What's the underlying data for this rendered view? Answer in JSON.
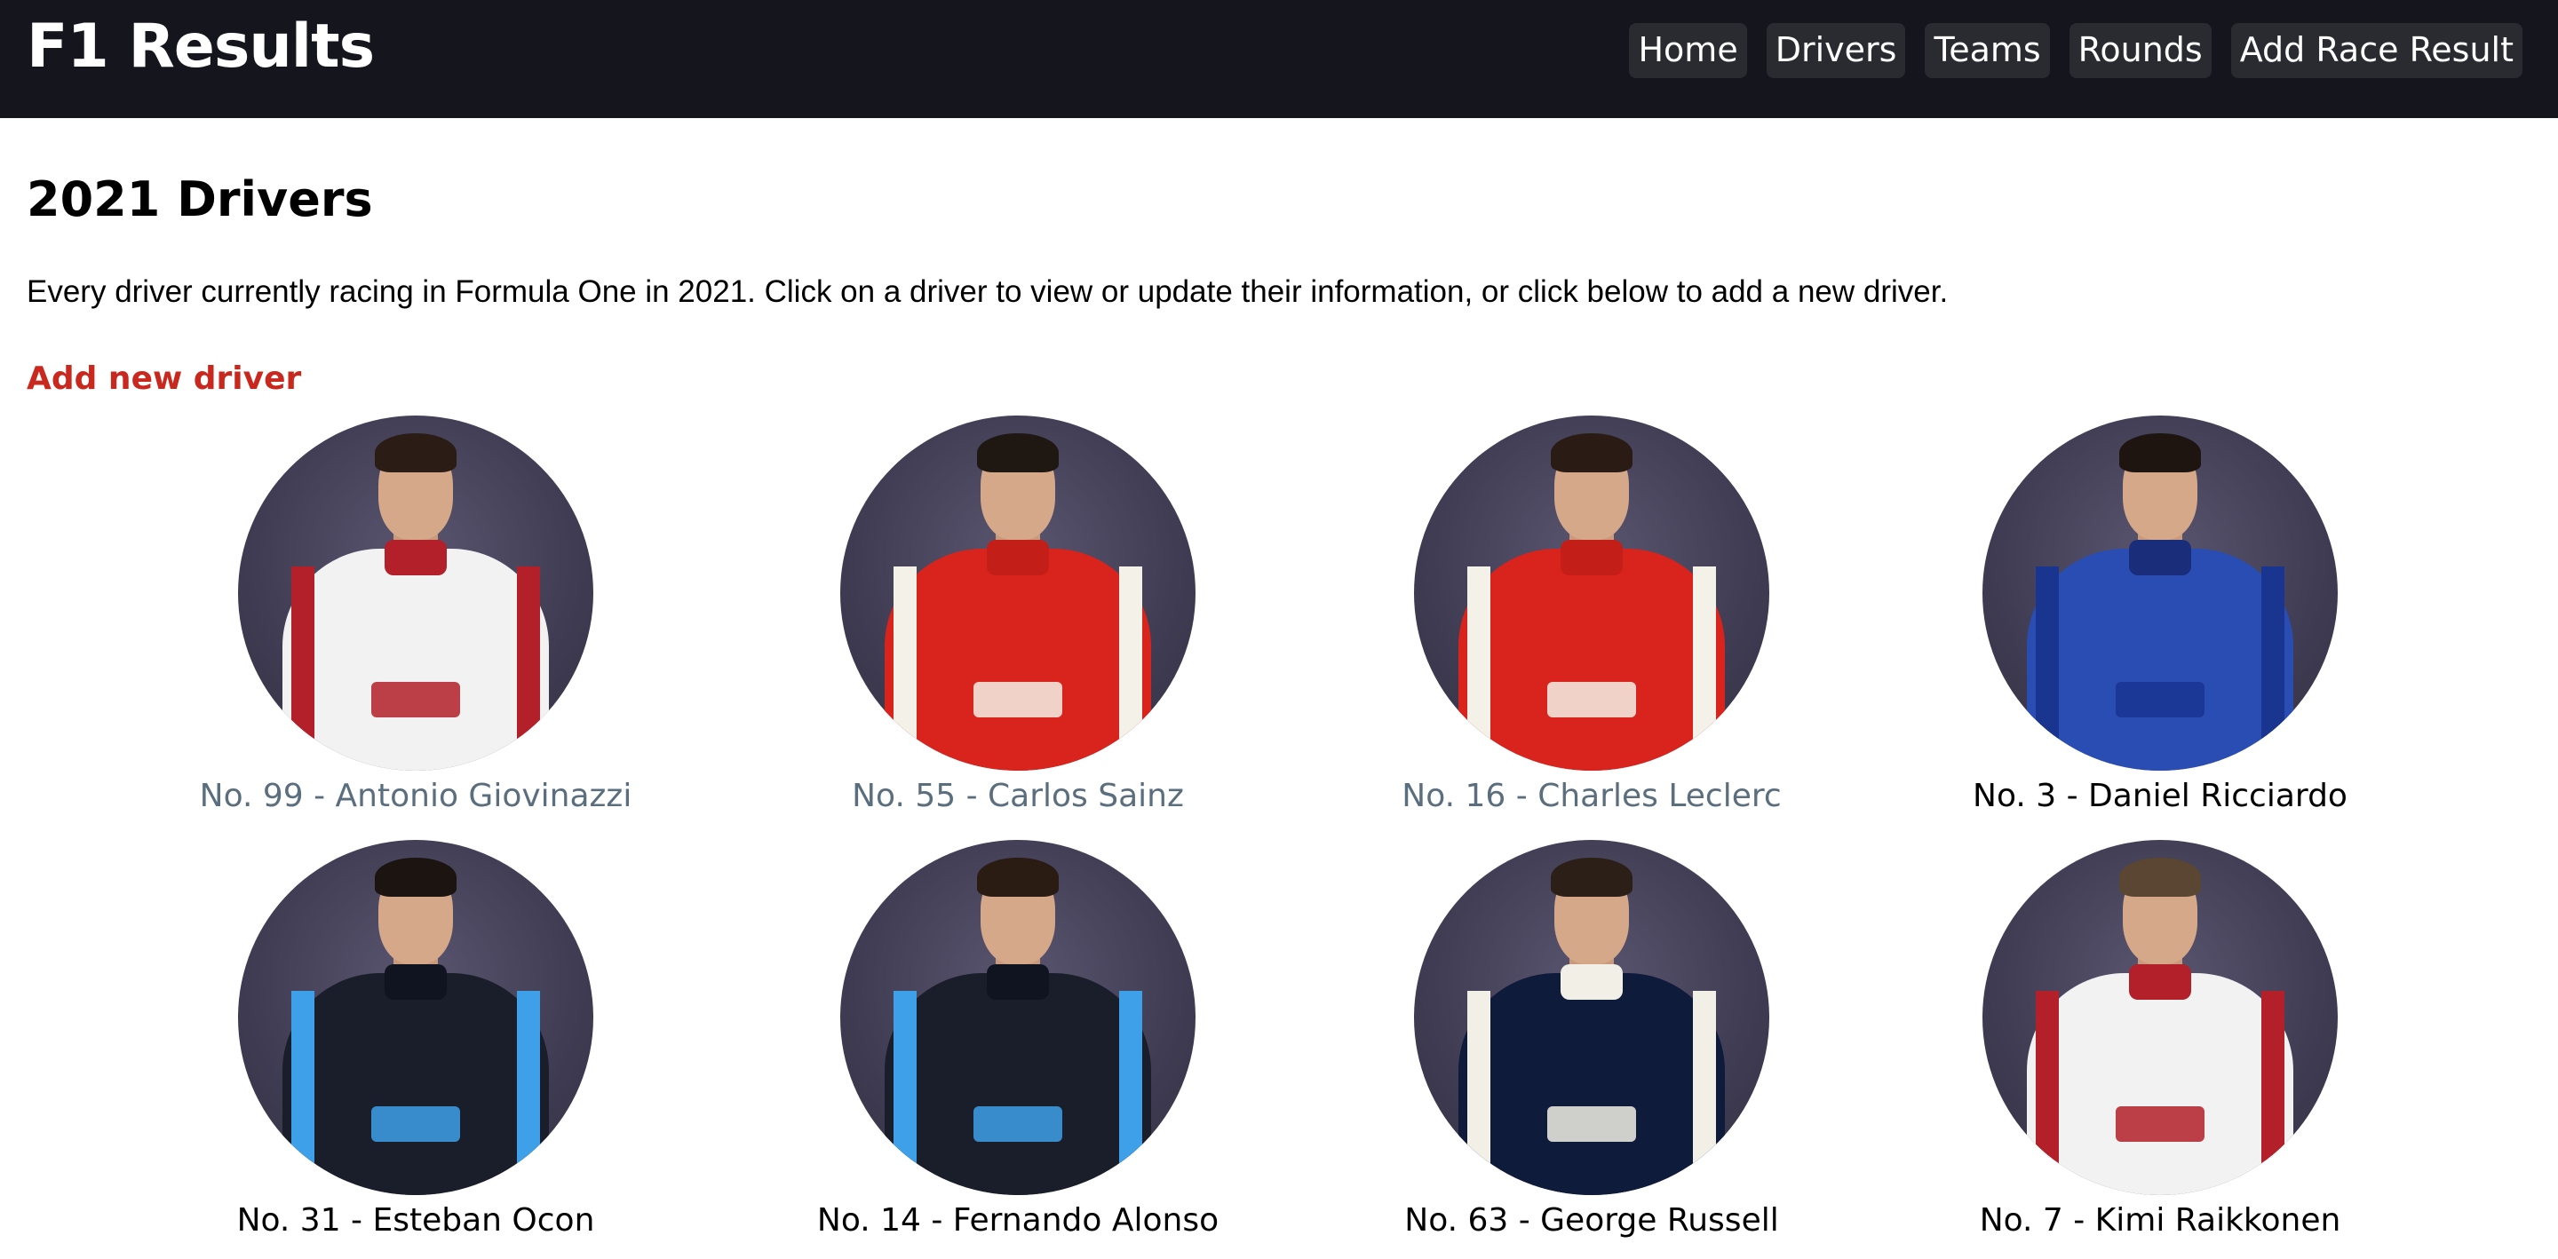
{
  "header": {
    "brand": "F1 Results",
    "nav": [
      "Home",
      "Drivers",
      "Teams",
      "Rounds",
      "Add Race Result"
    ]
  },
  "main": {
    "title": "2021 Drivers",
    "intro": "Every driver currently racing in Formula One in 2021. Click on a driver to view or update their information, or click below to add a new driver.",
    "add_label": "Add new driver"
  },
  "colors": {
    "navbar": "#15151e",
    "accent": "#c8281e",
    "visited_link": "#5b6e7e",
    "link": "#000000"
  },
  "drivers": [
    {
      "label": "No. 99 - Antonio Giovinazzi",
      "visited": true,
      "suit": "#f2f2f2",
      "trim": "#b3202a",
      "collar": "#b3202a",
      "hair": "#2b1d16"
    },
    {
      "label": "No. 55 - Carlos Sainz",
      "visited": true,
      "suit": "#d8241c",
      "trim": "#f4f1e8",
      "collar": "#c31e17",
      "hair": "#1f1712"
    },
    {
      "label": "No. 16 - Charles Leclerc",
      "visited": true,
      "suit": "#d8241c",
      "trim": "#f4f1e8",
      "collar": "#c31e17",
      "hair": "#2a1c14"
    },
    {
      "label": "No. 3 - Daniel Ricciardo",
      "visited": false,
      "suit": "#2a4db3",
      "trim": "#1a3590",
      "collar": "#1a2d7a",
      "hair": "#1e1511"
    },
    {
      "label": "No. 31 - Esteban Ocon",
      "visited": false,
      "suit": "#1a1e2a",
      "trim": "#3ea0e8",
      "collar": "#101320",
      "hair": "#1b1411"
    },
    {
      "label": "No. 14 - Fernando Alonso",
      "visited": false,
      "suit": "#1a1e2a",
      "trim": "#3ea0e8",
      "collar": "#101320",
      "hair": "#2a1b13"
    },
    {
      "label": "No. 63 - George Russell",
      "visited": false,
      "suit": "#0f1b3a",
      "trim": "#f1efe6",
      "collar": "#f1efe6",
      "hair": "#2b1f17"
    },
    {
      "label": "No. 7 - Kimi Raikkonen",
      "visited": false,
      "suit": "#f2f2f2",
      "trim": "#b3202a",
      "collar": "#b3202a",
      "hair": "#5a4632"
    }
  ]
}
